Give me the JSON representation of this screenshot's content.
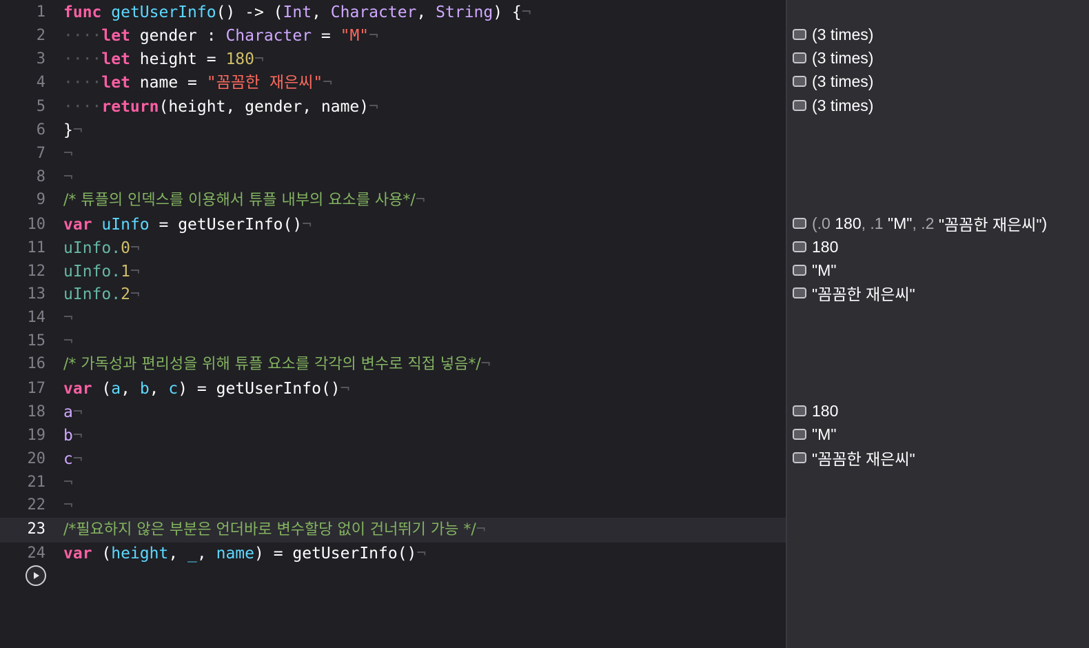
{
  "editor": {
    "line_numbers": [
      "1",
      "2",
      "3",
      "4",
      "5",
      "6",
      "7",
      "8",
      "9",
      "10",
      "11",
      "12",
      "13",
      "14",
      "15",
      "16",
      "17",
      "18",
      "19",
      "20",
      "21",
      "22",
      "23",
      "24"
    ],
    "active_line": "23",
    "pilcrow": "¬",
    "dot": "·",
    "l1": {
      "func": "func",
      "name": "getUserInfo",
      "paren_arrow": "() -> (",
      "int": "Int",
      "comma1": ", ",
      "char": "Character",
      "comma2": ", ",
      "string": "String",
      "close": ") {"
    },
    "l2": {
      "let": "let",
      "name": "gender",
      "colon": " : ",
      "type": "Character",
      "eq": " = ",
      "val": "\"M\""
    },
    "l3": {
      "let": "let",
      "name": "height",
      "eq": " = ",
      "val": "180"
    },
    "l4": {
      "let": "let",
      "name": "name",
      "eq": " = ",
      "val": "\"꼼꼼한 재은씨\""
    },
    "l5": {
      "ret": "return",
      "args": "(height, gender, name)"
    },
    "l6": {
      "brace": "}"
    },
    "l9": {
      "comment": "/* 튜플의 인덱스를 이용해서 튜플 내부의 요소를 사용*/"
    },
    "l10": {
      "var": "var",
      "name": "uInfo",
      "rest": " = getUserInfo()"
    },
    "l11": {
      "base": "uInfo.",
      "idx": "0"
    },
    "l12": {
      "base": "uInfo.",
      "idx": "1"
    },
    "l13": {
      "base": "uInfo.",
      "idx": "2"
    },
    "l16": {
      "comment": "/* 가독성과 편리성을 위해 튜플 요소를 각각의 변수로 직접 넣음*/"
    },
    "l17": {
      "var": "var",
      "open": " (",
      "a": "a",
      "c1": ", ",
      "b": "b",
      "c2": ", ",
      "c": "c",
      "rest": ") = getUserInfo()"
    },
    "l18": {
      "v": "a"
    },
    "l19": {
      "v": "b"
    },
    "l20": {
      "v": "c"
    },
    "l23": {
      "comment": "/*필요하지 않은 부분은 언더바로 변수할당 없이 건너뛰기 가능 */"
    },
    "l24": {
      "var": "var",
      "open": " (",
      "h": "height",
      "c1": ", ",
      "u": "_",
      "c2": ", ",
      "n": "name",
      "rest": ") = getUserInfo()"
    }
  },
  "results": {
    "r2": "(3 times)",
    "r3": "(3 times)",
    "r4": "(3 times)",
    "r5": "(3 times)",
    "r10": {
      "p0": "(.0 ",
      "v0": "180",
      "p1": ", .1 ",
      "v1": "\"M\"",
      "p2": ", .2 ",
      "v2": "\"꼼꼼한 재은씨\"",
      "p3": ")"
    },
    "r11": "180",
    "r12": "\"M\"",
    "r13": "\"꼼꼼한 재은씨\"",
    "r18": "180",
    "r19": "\"M\"",
    "r20": "\"꼼꼼한 재은씨\""
  },
  "colors": {
    "background": "#1f1f24",
    "results_panel": "#2e2e33",
    "keyword": "#fc5fa3",
    "function": "#5dd8ff",
    "type": "#d0a8ff",
    "string": "#fc6a5d",
    "number": "#d0bf69",
    "comment": "#84b360"
  },
  "icons": {
    "run": "play-icon",
    "result_toggle": "quick-look-icon"
  }
}
